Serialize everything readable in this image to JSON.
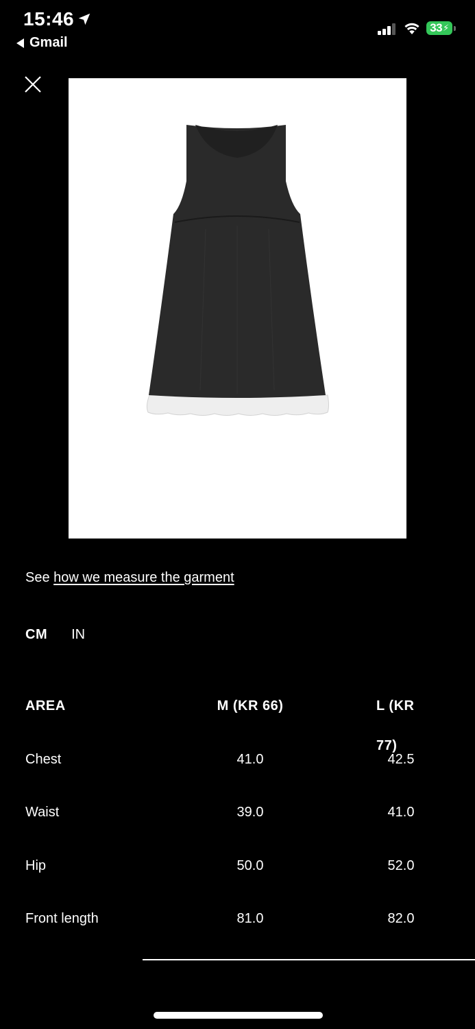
{
  "status_bar": {
    "time": "15:46",
    "back_app": "Gmail",
    "battery": "33"
  },
  "product_image": {
    "icon": "dress-icon"
  },
  "measure": {
    "prefix": "See ",
    "link_text": "how we measure the garment"
  },
  "units": {
    "active": "CM",
    "cm_label": "CM",
    "in_label": "IN"
  },
  "size_table": {
    "headers": [
      "AREA",
      "M (KR 66)",
      "L (KR 77)"
    ],
    "rows": [
      {
        "area": "Chest",
        "m": "41.0",
        "l": "42.5"
      },
      {
        "area": "Waist",
        "m": "39.0",
        "l": "41.0"
      },
      {
        "area": "Hip",
        "m": "50.0",
        "l": "52.0"
      },
      {
        "area": "Front length",
        "m": "81.0",
        "l": "82.0"
      }
    ]
  }
}
